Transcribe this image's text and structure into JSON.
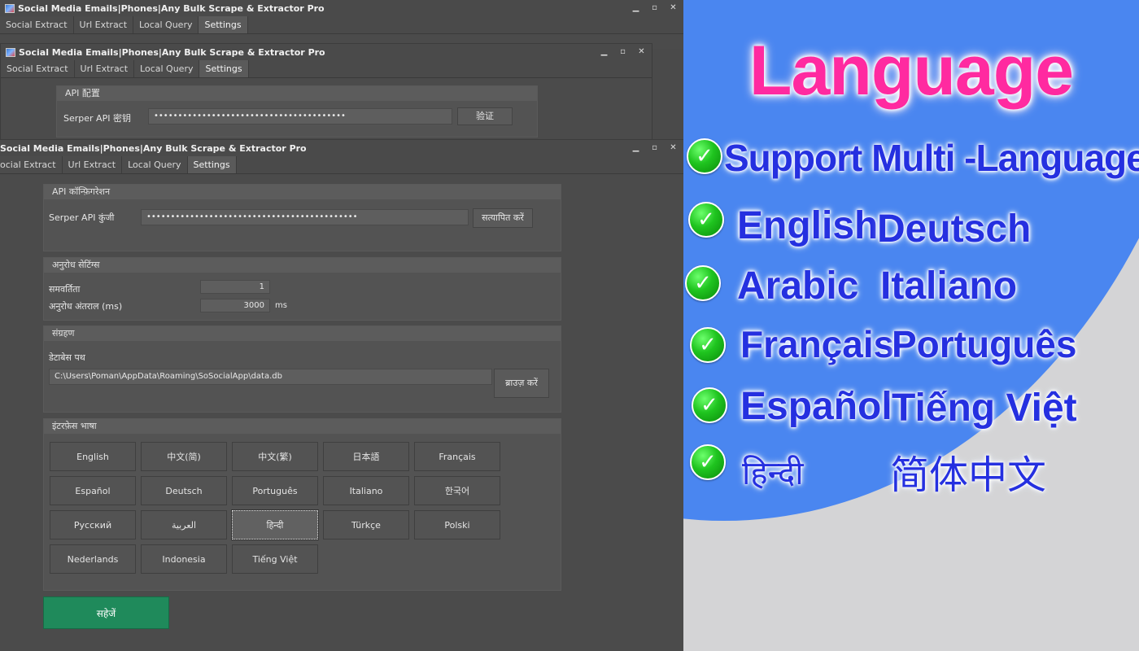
{
  "back_window": {
    "title": "Social Media Emails|Phones|Any Bulk Scrape & Extractor Pro",
    "tabs": [
      "Social Extract",
      "Url Extract",
      "Local Query",
      "Settings"
    ],
    "controls": [
      "▁",
      "▫",
      "✕"
    ]
  },
  "middle_window": {
    "title": "Social Media Emails|Phones|Any Bulk Scrape & Extractor Pro",
    "tabs": [
      "Social Extract",
      "Url Extract",
      "Local Query",
      "Settings"
    ],
    "controls": [
      "▁",
      "▫",
      "✕"
    ],
    "api_group_title": "API 配置",
    "api_key_label": "Serper API 密钥",
    "api_key_value": "••••••••••••••••••••••••••••••••••••••••",
    "verify_label": "验证"
  },
  "front_window": {
    "title": "Social Media Emails|Phones|Any Bulk Scrape & Extractor Pro",
    "tabs": [
      "ocial Extract",
      "Url Extract",
      "Local Query",
      "Settings"
    ],
    "controls": [
      "▁",
      "▫",
      "✕"
    ],
    "api": {
      "group_title": "API कॉन्फ़िगरेशन",
      "key_label": "Serper API कुंजी",
      "key_value": "••••••••••••••••••••••••••••••••••••••••••••",
      "verify_label": "सत्यापित करें"
    },
    "request": {
      "group_title": "अनुरोध सेटिंग्स",
      "concurrency_label": "समवर्तिता",
      "concurrency_value": "1",
      "interval_label": "अनुरोध अंतराल (ms)",
      "interval_value": "3000",
      "interval_unit": "ms"
    },
    "storage": {
      "group_title": "संग्रहण",
      "db_label": "डेटाबेस पथ",
      "db_path": "C:\\Users\\Poman\\AppData\\Roaming\\SoSocialApp\\data.db",
      "browse_label": "ब्राउज़ करें"
    },
    "language": {
      "group_title": "इंटरफ़ेस भाषा",
      "selected": "हिन्दी",
      "options": [
        "English",
        "中文(简)",
        "中文(繁)",
        "日本語",
        "Français",
        "Español",
        "Deutsch",
        "Português",
        "Italiano",
        "한국어",
        "Русский",
        "العربية",
        "हिन्दी",
        "Türkçe",
        "Polski",
        "Nederlands",
        "Indonesia",
        "Tiếng Việt"
      ]
    },
    "save_label": "सहेजें"
  },
  "promo": {
    "heading": "Language",
    "headline": "Support Multi -Language",
    "rows": [
      [
        "English",
        "Deutsch"
      ],
      [
        "Arabic",
        "Italiano"
      ],
      [
        "Français",
        "Português"
      ],
      [
        "Español",
        "Tiếng Việt"
      ],
      [
        "हिन्दी",
        "简体中文"
      ]
    ],
    "colors": {
      "heading": "#ff2aa0",
      "text": "#2530e0",
      "check": "#1fc41f",
      "blue_bg": "#4a86f0",
      "save": "#1f8a5b"
    }
  }
}
